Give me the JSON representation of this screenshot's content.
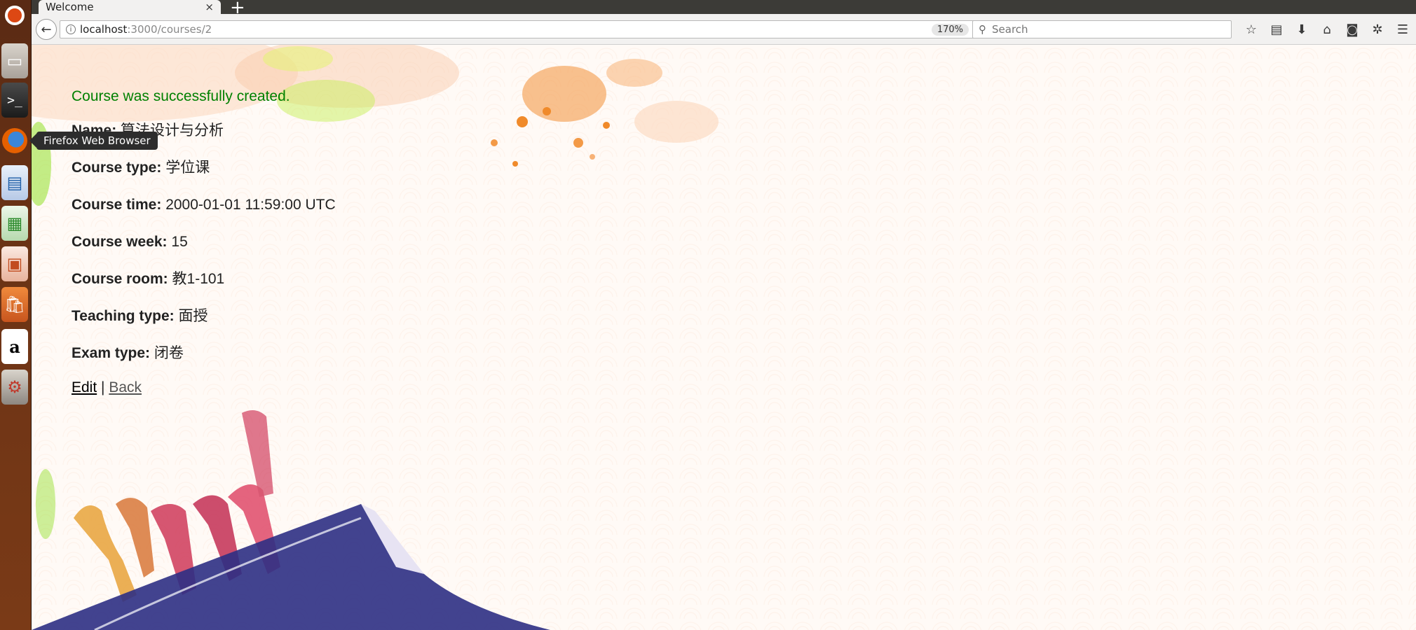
{
  "browser": {
    "tab_title": "Welcome",
    "tab_close": "×",
    "new_tab": "+",
    "url_host": "localhost",
    "url_path": ":3000/courses/2",
    "zoom": "170%",
    "search_placeholder": "Search"
  },
  "launcher": {
    "tooltip": "Firefox Web Browser",
    "terminal_glyph": ">_",
    "amazon_glyph": "a"
  },
  "page": {
    "notice": "Course was successfully created.",
    "fields": [
      {
        "label": "Name:",
        "value": "算法设计与分析"
      },
      {
        "label": "Course type:",
        "value": "学位课"
      },
      {
        "label": "Course time:",
        "value": "2000-01-01 11:59:00 UTC"
      },
      {
        "label": "Course week:",
        "value": "15"
      },
      {
        "label": "Course room:",
        "value": "教1-101"
      },
      {
        "label": "Teaching type:",
        "value": "面授"
      },
      {
        "label": "Exam type:",
        "value": "闭卷"
      }
    ],
    "edit_link": "Edit",
    "separator": "|",
    "back_link": "Back"
  },
  "colors": {
    "notice": "#008000",
    "launcher_bg": "#6b3315",
    "titlebar_bg": "#3c3b37"
  }
}
